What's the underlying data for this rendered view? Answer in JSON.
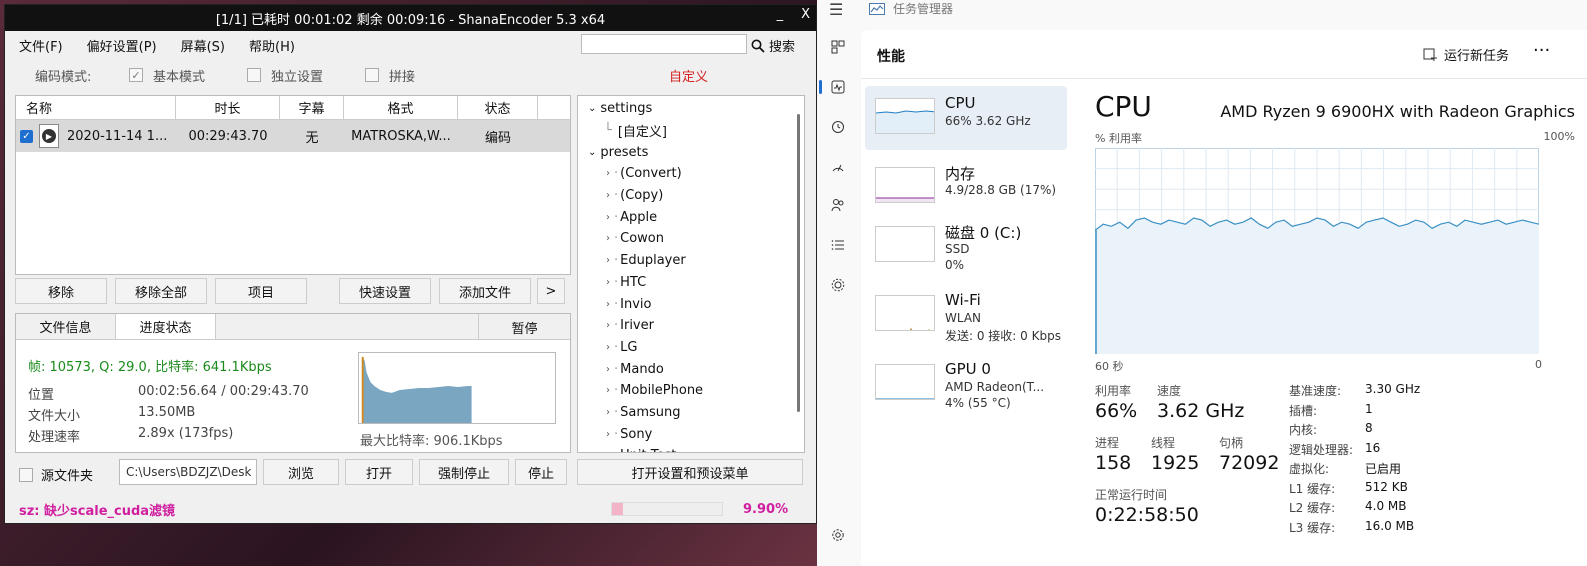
{
  "shana": {
    "title": "[1/1] 已耗时 00:01:02  剩余 00:09:16 - ShanaEncoder 5.3 x64",
    "min": "_",
    "close": "X",
    "menu": [
      "文件(F)",
      "偏好设置(P)",
      "屏幕(S)",
      "帮助(H)"
    ],
    "search_label": "搜索",
    "mode_label": "编码模式:",
    "modes": [
      {
        "label": "基本模式",
        "checked": true
      },
      {
        "label": "独立设置",
        "checked": false
      },
      {
        "label": "拼接",
        "checked": false
      }
    ],
    "custom_label": "自定义",
    "columns": [
      "名称",
      "时长",
      "字幕",
      "格式",
      "状态"
    ],
    "file_row": {
      "name": "2020-11-14 1...",
      "duration": "00:29:43.70",
      "subtitle": "无",
      "format": "MATROSKA,W...",
      "status": "编码"
    },
    "tree": {
      "root1": "settings",
      "child1": "[自定义]",
      "root2": "presets",
      "presets": [
        "(Convert)",
        "(Copy)",
        "Apple",
        "Cowon",
        "Eduplayer",
        "HTC",
        "Invio",
        "Iriver",
        "LG",
        "Mando",
        "MobilePhone",
        "Samsung",
        "Sony",
        "Unit Test"
      ]
    },
    "buttons": {
      "remove": "移除",
      "remove_all": "移除全部",
      "item": "项目",
      "quick_setup": "快速设置",
      "add_file": "添加文件",
      "more": ">"
    },
    "tabs": [
      "文件信息",
      "进度状态"
    ],
    "pause": "暂停",
    "progress_line": "帧: 10573, Q: 29.0, 比特率: 641.1Kbps",
    "stats": [
      {
        "label": "位置",
        "value": "00:02:56.64 / 00:29:43.70"
      },
      {
        "label": "文件大小",
        "value": "13.50MB"
      },
      {
        "label": "处理速率",
        "value": "2.89x (173fps)"
      }
    ],
    "max_bitrate": "最大比特率: 906.1Kbps",
    "source_folder": "源文件夹",
    "source_path": "C:\\Users\\BDZJZ\\Desk",
    "bottom_buttons": {
      "browse": "浏览",
      "open": "打开",
      "force_stop": "强制停止",
      "stop": "停止",
      "open_settings": "打开设置和预设菜单"
    },
    "error": "sz: 缺少scale_cuda滤镜",
    "progress_fraction": 0.099,
    "progress_pct": "9.90%",
    "colors": {
      "green": "#1a8a1a",
      "error": "#d020a0",
      "custom": "#d42020"
    }
  },
  "taskmgr": {
    "title": "任务管理器",
    "page": "性能",
    "run_new_task": "运行新任务",
    "nav_icons": [
      "hamburger-icon",
      "processes-icon",
      "performance-icon",
      "history-icon",
      "startup-icon",
      "users-icon",
      "details-icon",
      "services-icon",
      "settings-icon"
    ],
    "items": [
      {
        "name": "CPU",
        "sub1": "66% 3.62 GHz",
        "sub2": "",
        "color": "#1e7fc4"
      },
      {
        "name": "内存",
        "sub1": "4.9/28.8 GB (17%)",
        "sub2": "",
        "color": "#8b2a9a"
      },
      {
        "name": "磁盘 0 (C:)",
        "sub1": "SSD",
        "sub2": "0%",
        "color": "#4a8a1a"
      },
      {
        "name": "Wi-Fi",
        "sub1": "WLAN",
        "sub2": "发送: 0 接收: 0 Kbps",
        "color": "#b07a10"
      },
      {
        "name": "GPU 0",
        "sub1": "AMD Radeon(T...",
        "sub2": "4% (55 °C)",
        "color": "#1e7fc4"
      }
    ],
    "cpu": {
      "title": "CPU",
      "model": "AMD Ryzen 9 6900HX with Radeon Graphics",
      "y_label": "% 利用率",
      "y_max": "100%",
      "x_left": "60 秒",
      "x_right": "0",
      "utilization_label": "利用率",
      "utilization": "66%",
      "speed_label": "速度",
      "speed": "3.62 GHz",
      "processes_label": "进程",
      "processes": "158",
      "threads_label": "线程",
      "threads": "1925",
      "handles_label": "句柄",
      "handles": "72092",
      "uptime_label": "正常运行时间",
      "uptime": "0:22:58:50",
      "specs": [
        {
          "label": "基准速度:",
          "value": "3.30 GHz"
        },
        {
          "label": "插槽:",
          "value": "1"
        },
        {
          "label": "内核:",
          "value": "8"
        },
        {
          "label": "逻辑处理器:",
          "value": "16"
        },
        {
          "label": "虚拟化:",
          "value": "已启用"
        },
        {
          "label": "L1 缓存:",
          "value": "512 KB"
        },
        {
          "label": "L2 缓存:",
          "value": "4.0 MB"
        },
        {
          "label": "L3 缓存:",
          "value": "16.0 MB"
        }
      ]
    },
    "cpu_history": [
      60,
      63,
      62,
      64,
      61,
      65,
      66,
      64,
      63,
      65,
      64,
      63,
      66,
      65,
      62,
      64,
      65,
      63,
      64,
      66,
      63,
      61,
      64,
      65,
      62,
      63,
      64,
      66,
      65,
      62,
      64,
      63,
      61,
      64,
      65,
      66,
      64,
      62,
      63,
      65,
      64,
      61,
      63,
      64,
      62,
      65,
      64,
      63,
      64,
      65,
      63,
      64,
      65,
      64,
      63
    ],
    "colors": {
      "accent": "#1e6fd0",
      "cpu_line": "#3a8fc4",
      "cpu_fill": "#eaf3fa"
    }
  }
}
